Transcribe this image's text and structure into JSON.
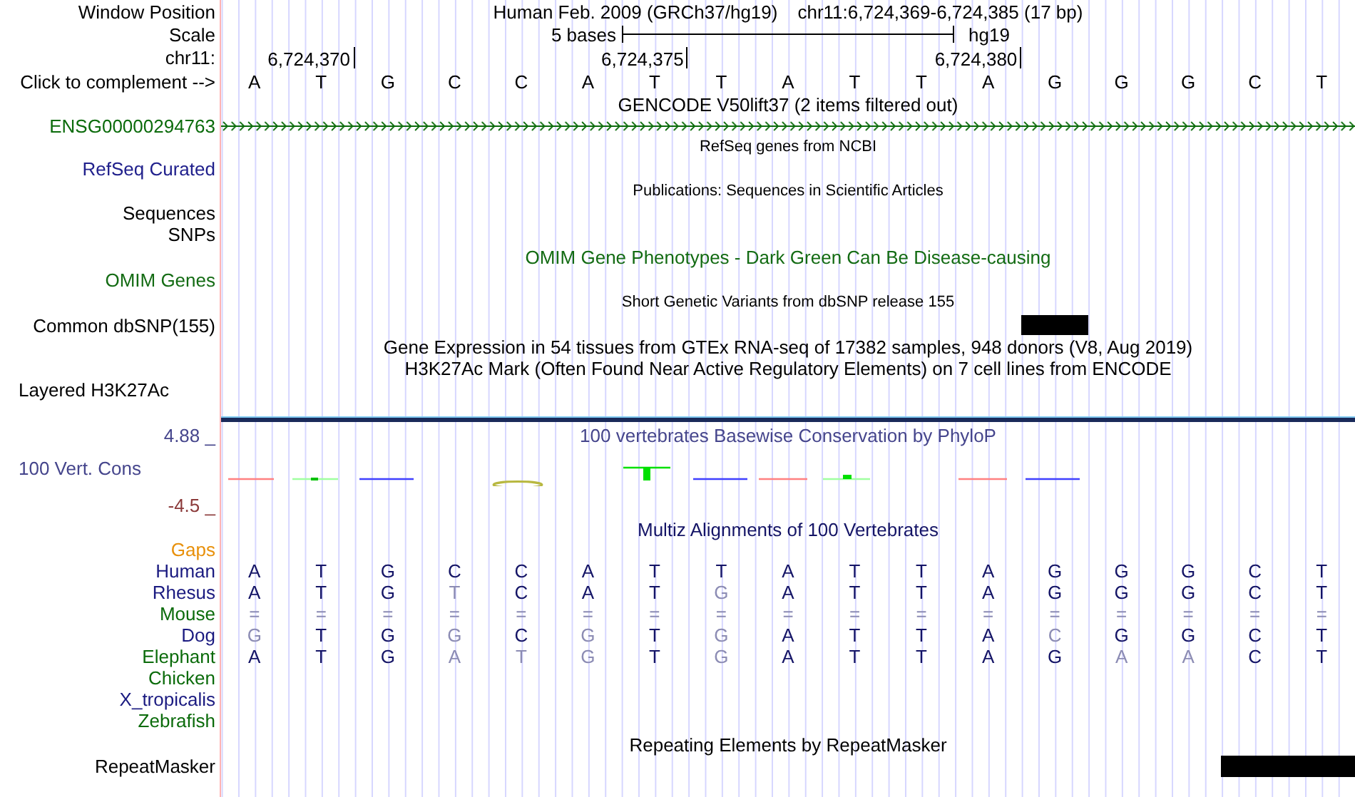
{
  "window_position": {
    "label": "Window Position",
    "assembly": "Human Feb. 2009 (GRCh37/hg19)",
    "range": "chr11:6,724,369-6,724,385 (17 bp)"
  },
  "scale": {
    "label": "Scale",
    "span": "5 bases",
    "assembly": "hg19"
  },
  "ruler": {
    "label": "chr11:",
    "ticks": [
      "6,724,370",
      "6,724,375",
      "6,724,380"
    ]
  },
  "sequence": {
    "label": "Click to complement -->",
    "bases": [
      "A",
      "T",
      "G",
      "C",
      "C",
      "A",
      "T",
      "T",
      "A",
      "T",
      "T",
      "A",
      "G",
      "G",
      "G",
      "C",
      "T"
    ]
  },
  "gencode": {
    "title": "GENCODE V50lift37 (2 items filtered out)",
    "gene": "ENSG00000294763"
  },
  "refseq": {
    "title": "RefSeq genes from NCBI",
    "label": "RefSeq Curated"
  },
  "publications": {
    "title": "Publications: Sequences in Scientific Articles",
    "labels": [
      "Sequences",
      "SNPs"
    ]
  },
  "omim": {
    "title": "OMIM Gene Phenotypes - Dark Green Can Be Disease-causing",
    "label": "OMIM Genes"
  },
  "dbsnp": {
    "title": "Short Genetic Variants from dbSNP release 155",
    "label": "Common dbSNP(155)"
  },
  "gtex": {
    "title": "Gene Expression in 54 tissues from GTEx RNA-seq of 17382 samples, 948 donors (V8, Aug 2019)"
  },
  "h3k27ac": {
    "title": "H3K27Ac Mark (Often Found Near Active Regulatory Elements) on 7 cell lines from ENCODE",
    "label": "Layered H3K27Ac"
  },
  "conservation": {
    "title": "100 vertebrates Basewise Conservation by PhyloP",
    "label": "100 Vert. Cons",
    "max": "4.88 _",
    "min": "-4.5 _"
  },
  "multiz": {
    "title": "Multiz Alignments of 100 Vertebrates",
    "gaps_label": "Gaps",
    "species": [
      {
        "name": "Human",
        "color": "#1a1a80",
        "bases": [
          {
            "base": "A",
            "matches": true
          },
          {
            "base": "T",
            "matches": true
          },
          {
            "base": "G",
            "matches": true
          },
          {
            "base": "C",
            "matches": true
          },
          {
            "base": "C",
            "matches": true
          },
          {
            "base": "A",
            "matches": true
          },
          {
            "base": "T",
            "matches": true
          },
          {
            "base": "T",
            "matches": true
          },
          {
            "base": "A",
            "matches": true
          },
          {
            "base": "T",
            "matches": true
          },
          {
            "base": "T",
            "matches": true
          },
          {
            "base": "A",
            "matches": true
          },
          {
            "base": "G",
            "matches": true
          },
          {
            "base": "G",
            "matches": true
          },
          {
            "base": "G",
            "matches": true
          },
          {
            "base": "C",
            "matches": true
          },
          {
            "base": "T",
            "matches": true
          }
        ]
      },
      {
        "name": "Rhesus",
        "color": "#1a1a80",
        "bases": [
          {
            "base": "A",
            "matches": true
          },
          {
            "base": "T",
            "matches": true
          },
          {
            "base": "G",
            "matches": true
          },
          {
            "base": "T",
            "matches": false
          },
          {
            "base": "C",
            "matches": true
          },
          {
            "base": "A",
            "matches": true
          },
          {
            "base": "T",
            "matches": true
          },
          {
            "base": "G",
            "matches": false
          },
          {
            "base": "A",
            "matches": true
          },
          {
            "base": "T",
            "matches": true
          },
          {
            "base": "T",
            "matches": true
          },
          {
            "base": "A",
            "matches": true
          },
          {
            "base": "G",
            "matches": true
          },
          {
            "base": "G",
            "matches": true
          },
          {
            "base": "G",
            "matches": true
          },
          {
            "base": "C",
            "matches": true
          },
          {
            "base": "T",
            "matches": true
          }
        ]
      },
      {
        "name": "Mouse",
        "color": "#0b6b0b",
        "bases": [
          {
            "base": "=",
            "matches": false
          },
          {
            "base": "=",
            "matches": false
          },
          {
            "base": "=",
            "matches": false
          },
          {
            "base": "=",
            "matches": false
          },
          {
            "base": "=",
            "matches": false
          },
          {
            "base": "=",
            "matches": false
          },
          {
            "base": "=",
            "matches": false
          },
          {
            "base": "=",
            "matches": false
          },
          {
            "base": "=",
            "matches": false
          },
          {
            "base": "=",
            "matches": false
          },
          {
            "base": "=",
            "matches": false
          },
          {
            "base": "=",
            "matches": false
          },
          {
            "base": "=",
            "matches": false
          },
          {
            "base": "=",
            "matches": false
          },
          {
            "base": "=",
            "matches": false
          },
          {
            "base": "=",
            "matches": false
          },
          {
            "base": "=",
            "matches": false
          }
        ]
      },
      {
        "name": "Dog",
        "color": "#1a1a80",
        "bases": [
          {
            "base": "G",
            "matches": false
          },
          {
            "base": "T",
            "matches": true
          },
          {
            "base": "G",
            "matches": true
          },
          {
            "base": "G",
            "matches": false
          },
          {
            "base": "C",
            "matches": true
          },
          {
            "base": "G",
            "matches": false
          },
          {
            "base": "T",
            "matches": true
          },
          {
            "base": "G",
            "matches": false
          },
          {
            "base": "A",
            "matches": true
          },
          {
            "base": "T",
            "matches": true
          },
          {
            "base": "T",
            "matches": true
          },
          {
            "base": "A",
            "matches": true
          },
          {
            "base": "C",
            "matches": false
          },
          {
            "base": "G",
            "matches": true
          },
          {
            "base": "G",
            "matches": true
          },
          {
            "base": "C",
            "matches": true
          },
          {
            "base": "T",
            "matches": true
          }
        ]
      },
      {
        "name": "Elephant",
        "color": "#0b6b0b",
        "bases": [
          {
            "base": "A",
            "matches": true
          },
          {
            "base": "T",
            "matches": true
          },
          {
            "base": "G",
            "matches": true
          },
          {
            "base": "A",
            "matches": false
          },
          {
            "base": "T",
            "matches": false
          },
          {
            "base": "G",
            "matches": false
          },
          {
            "base": "T",
            "matches": true
          },
          {
            "base": "G",
            "matches": false
          },
          {
            "base": "A",
            "matches": true
          },
          {
            "base": "T",
            "matches": true
          },
          {
            "base": "T",
            "matches": true
          },
          {
            "base": "A",
            "matches": true
          },
          {
            "base": "G",
            "matches": true
          },
          {
            "base": "A",
            "matches": false
          },
          {
            "base": "A",
            "matches": false
          },
          {
            "base": "C",
            "matches": true
          },
          {
            "base": "T",
            "matches": true
          }
        ]
      },
      {
        "name": "Chicken",
        "color": "#0b6b0b"
      },
      {
        "name": "X_tropicalis",
        "color": "#1a1a80"
      },
      {
        "name": "Zebrafish",
        "color": "#0b6b0b"
      }
    ]
  },
  "repeatmasker": {
    "title": "Repeating Elements by RepeatMasker",
    "label": "RepeatMasker"
  }
}
